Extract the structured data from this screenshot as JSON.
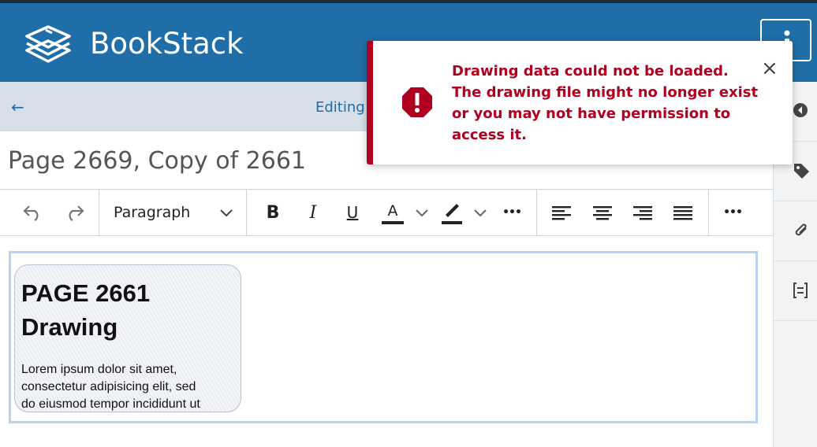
{
  "app": {
    "name": "BookStack"
  },
  "subbar": {
    "back_icon": "←",
    "editing_label": "Editing P"
  },
  "page": {
    "title": "Page 2669,  Copy of 2661"
  },
  "toolbar": {
    "block_format": "Paragraph",
    "bold": "B",
    "italic": "I",
    "underline": "U",
    "text_color": "A",
    "more": "•••"
  },
  "drawing": {
    "title_line1": "PAGE 2661",
    "title_line2": "Drawing",
    "body_line1": "Lorem ipsum dolor sit amet,",
    "body_line2": "consectetur adipisicing elit, sed",
    "body_line3": "do eiusmod tempor incididunt ut"
  },
  "notification": {
    "type": "error",
    "message": "Drawing data could not be loaded. The drawing file might no longer exist or you may not have permission to access it.",
    "close_icon": "×"
  },
  "colors": {
    "primary": "#206ea7",
    "error": "#b00020",
    "subbar": "#d7e0e8"
  }
}
